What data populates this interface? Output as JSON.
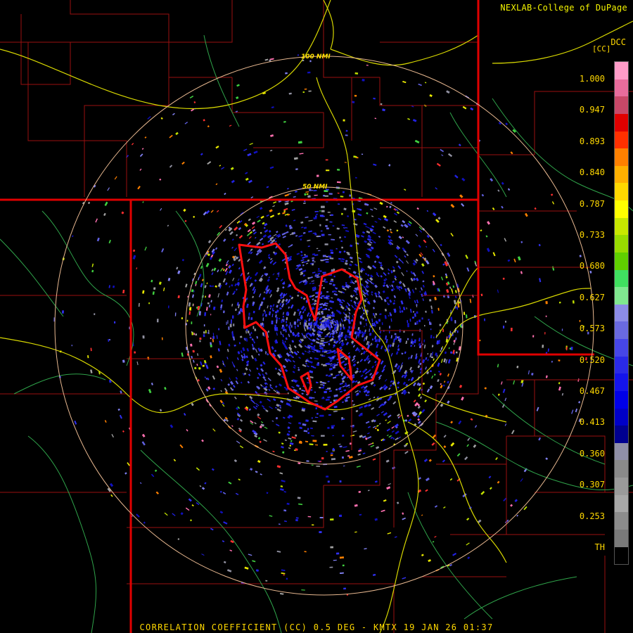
{
  "credit": "NEXLAB-College of DuPage",
  "product_code": "DCC",
  "legend_unit": "[CC]",
  "legend_ticks": [
    "1.000",
    "0.947",
    "0.893",
    "0.840",
    "0.787",
    "0.733",
    "0.680",
    "0.627",
    "0.573",
    "0.520",
    "0.467",
    "0.413",
    "0.360",
    "0.307",
    "0.253",
    "TH"
  ],
  "legend_colors": [
    "#ff9cc8",
    "#e86c9c",
    "#c84868",
    "#e00000",
    "#ff3000",
    "#ff8000",
    "#ffb000",
    "#ffd800",
    "#ffff00",
    "#c8e800",
    "#98dc00",
    "#60d000",
    "#40e060",
    "#80e890",
    "#8c8ce8",
    "#6a6ae0",
    "#4646e8",
    "#2a2ae8",
    "#1414ec",
    "#0000e8",
    "#0000c8",
    "#000090",
    "#9090a8",
    "#8a8a8a",
    "#9a9a9a",
    "#a8a8a8",
    "#8c8c8c",
    "#7a7a7a",
    "#000000"
  ],
  "ring_labels": {
    "outer": "100 NMI",
    "inner": "50 NMI"
  },
  "footer": "CORRELATION COEFFICIENT (CC) 0.5 DEG - KMTX 19 JAN 26 01:37"
}
